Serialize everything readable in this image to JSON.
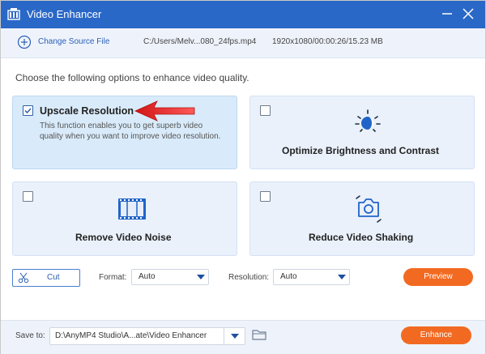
{
  "window": {
    "title": "Video Enhancer",
    "icons": {
      "app": "film-app-icon",
      "minimize": "minimize-icon",
      "close": "close-icon"
    }
  },
  "source": {
    "change_label": "Change Source File",
    "path": "C:/Users/Melv...080_24fps.mp4",
    "meta": "1920x1080/00:00:26/15.23 MB"
  },
  "prompt": "Choose the following options to enhance video quality.",
  "options": [
    {
      "title": "Upscale Resolution",
      "checked": true,
      "description": "This function enables you to get superb video quality when you want to improve video resolution."
    },
    {
      "title": "Optimize Brightness and Contrast",
      "checked": false,
      "icon": "brightness-icon"
    },
    {
      "title": "Remove Video Noise",
      "checked": false,
      "icon": "film-strip-icon"
    },
    {
      "title": "Reduce Video Shaking",
      "checked": false,
      "icon": "stabilize-camera-icon"
    }
  ],
  "controls": {
    "cut_label": "Cut",
    "format_label": "Format:",
    "format_value": "Auto",
    "resolution_label": "Resolution:",
    "resolution_value": "Auto",
    "preview_label": "Preview"
  },
  "save": {
    "label": "Save to:",
    "path": "D:\\AnyMP4 Studio\\A...ate\\Video Enhancer",
    "enhance_label": "Enhance"
  },
  "colors": {
    "titlebar": "#2a68c8",
    "accent_blue": "#2b5fb6",
    "orange": "#f26a21",
    "card_bg": "#eaf1fb",
    "card_selected_bg": "#d9ebfa",
    "annotation_arrow": "#e32b2b"
  }
}
